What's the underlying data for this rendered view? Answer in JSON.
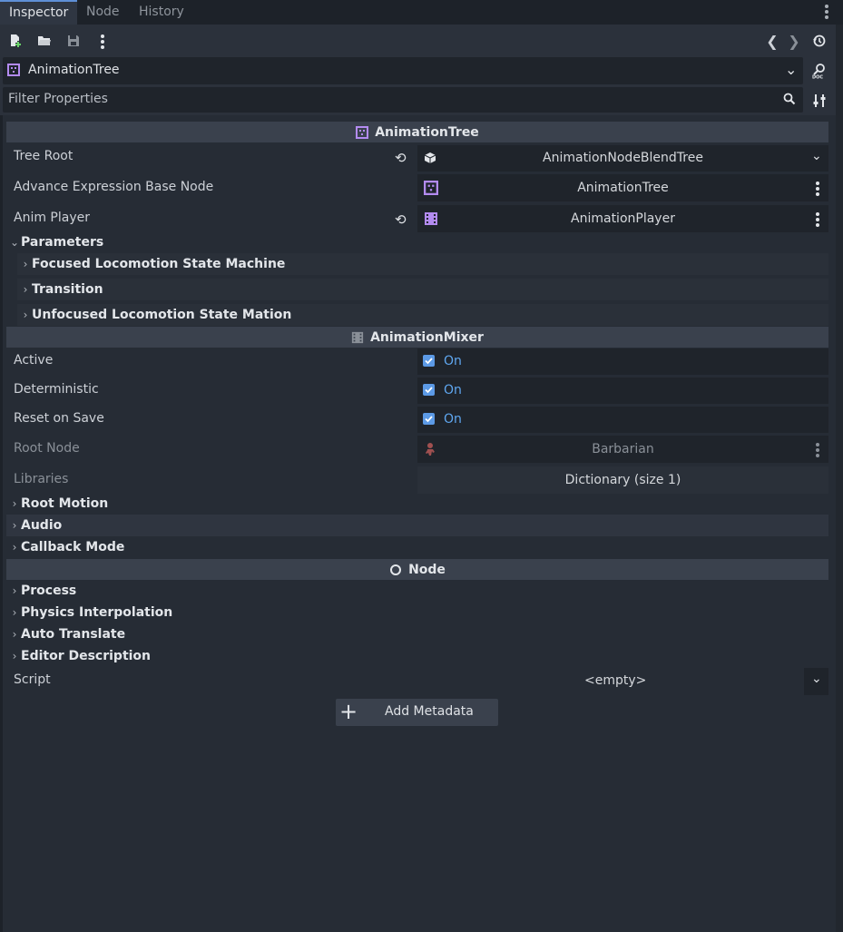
{
  "tabs": [
    {
      "label": "Inspector",
      "active": true
    },
    {
      "label": "Node",
      "active": false
    },
    {
      "label": "History",
      "active": false
    }
  ],
  "node_selector": {
    "label": "AnimationTree"
  },
  "filter": {
    "placeholder": "Filter Properties"
  },
  "sections": {
    "animation_tree": {
      "title": "AnimationTree",
      "props": {
        "tree_root": {
          "label": "Tree Root",
          "value": "AnimationNodeBlendTree"
        },
        "advance_expression": {
          "label": "Advance Expression Base Node",
          "value": "AnimationTree"
        },
        "anim_player": {
          "label": "Anim Player",
          "value": "AnimationPlayer"
        }
      },
      "parameters": {
        "label": "Parameters",
        "children": [
          "Focused Locomotion State Machine",
          "Transition",
          "Unfocused Locomotion State Mation"
        ]
      }
    },
    "animation_mixer": {
      "title": "AnimationMixer",
      "props": {
        "active": {
          "label": "Active",
          "value": "On"
        },
        "deterministic": {
          "label": "Deterministic",
          "value": "On"
        },
        "reset_on_save": {
          "label": "Reset on Save",
          "value": "On"
        },
        "root_node": {
          "label": "Root Node",
          "value": "Barbarian"
        },
        "libraries": {
          "label": "Libraries",
          "value": "Dictionary (size 1)"
        }
      },
      "groups": [
        "Root Motion",
        "Audio",
        "Callback Mode"
      ]
    },
    "node": {
      "title": "Node",
      "groups": [
        "Process",
        "Physics Interpolation",
        "Auto Translate",
        "Editor Description"
      ],
      "script": {
        "label": "Script",
        "value": "<empty>"
      }
    }
  },
  "add_metadata": {
    "label": "Add Metadata"
  },
  "colors": {
    "accent": "#5e8fd6",
    "checkbox": "#5c9ae6",
    "on_text": "#5fa7f0",
    "node_icon": "#b38bf0"
  }
}
